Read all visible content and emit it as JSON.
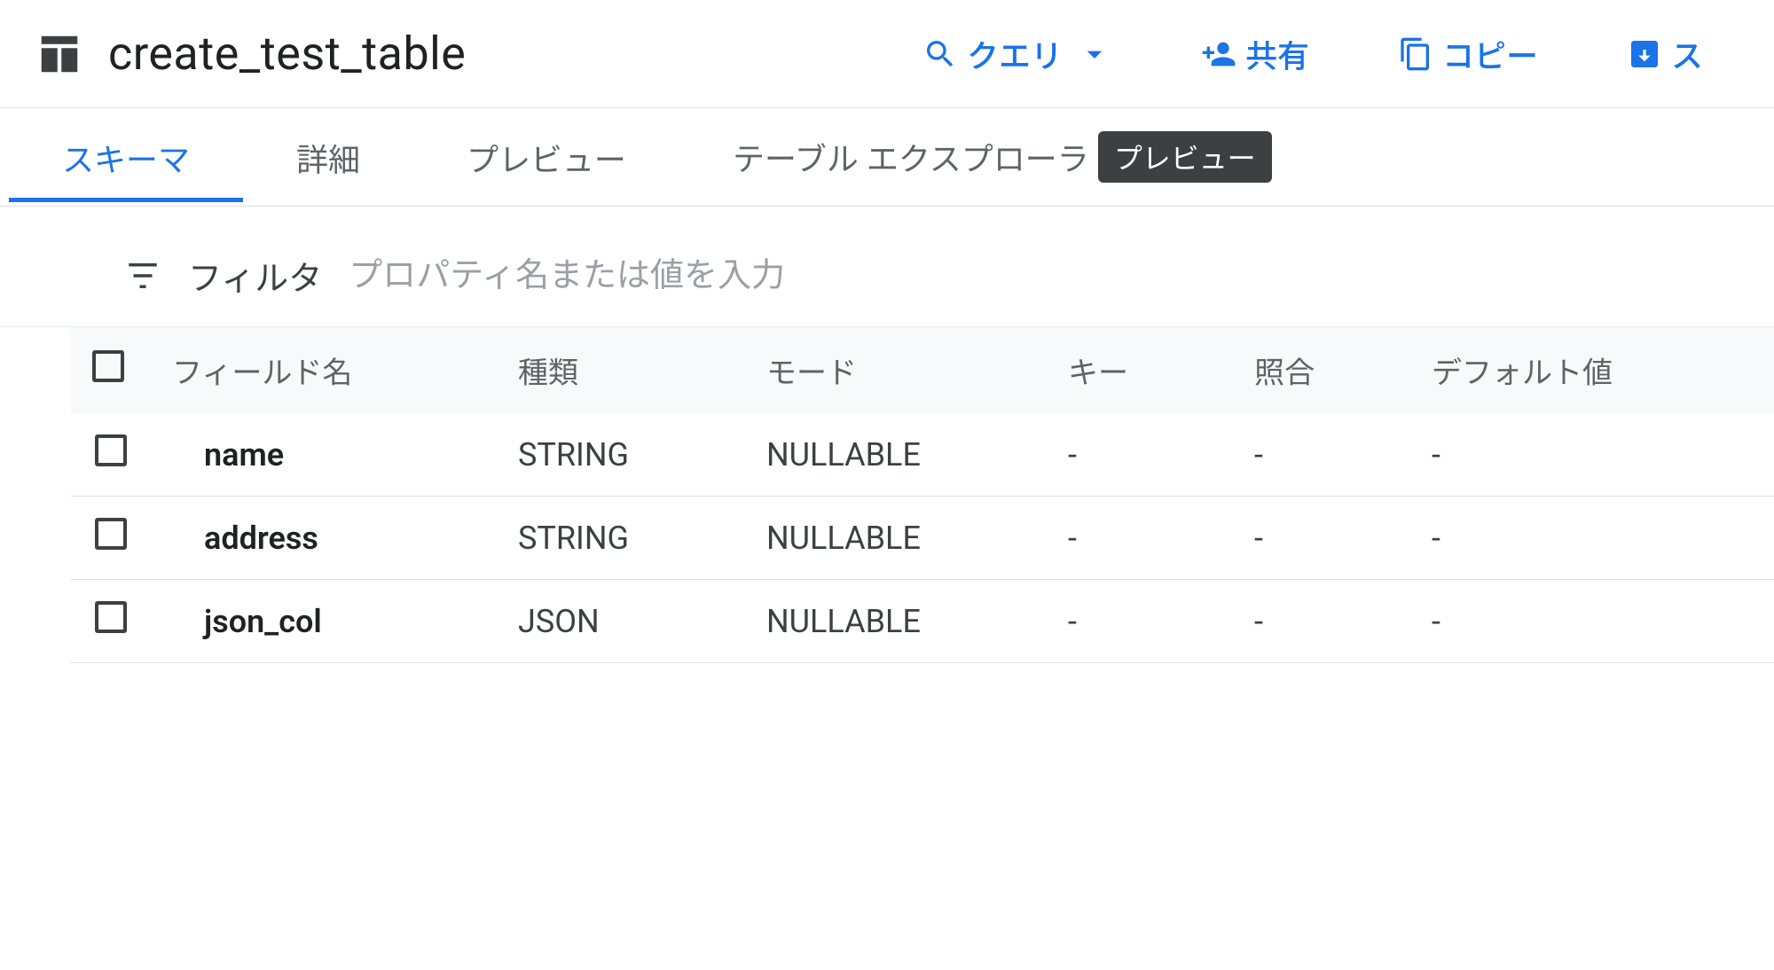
{
  "header": {
    "title": "create_test_table"
  },
  "actions": {
    "query": "クエリ",
    "share": "共有",
    "copy": "コピー",
    "snapshot": "ス"
  },
  "tabs": {
    "schema": "スキーマ",
    "details": "詳細",
    "preview": "プレビュー",
    "table_explorer": "テーブル エクスプローラ",
    "explorer_badge": "プレビュー"
  },
  "filter": {
    "label": "フィルタ",
    "placeholder": "プロパティ名または値を入力"
  },
  "schema": {
    "columns": {
      "field_name": "フィールド名",
      "type": "種類",
      "mode": "モード",
      "key": "キー",
      "collation": "照合",
      "default": "デフォルト値"
    },
    "rows": [
      {
        "name": "name",
        "type": "STRING",
        "mode": "NULLABLE",
        "key": "-",
        "collation": "-",
        "default": "-"
      },
      {
        "name": "address",
        "type": "STRING",
        "mode": "NULLABLE",
        "key": "-",
        "collation": "-",
        "default": "-"
      },
      {
        "name": "json_col",
        "type": "JSON",
        "mode": "NULLABLE",
        "key": "-",
        "collation": "-",
        "default": "-"
      }
    ]
  }
}
